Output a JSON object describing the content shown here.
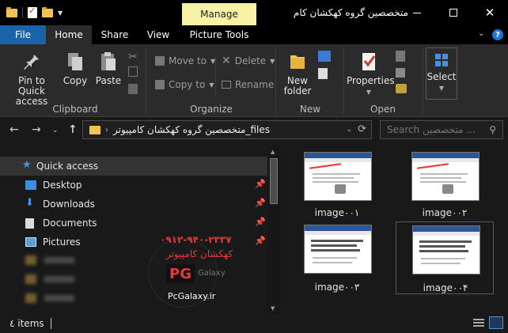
{
  "titlebar": {
    "context_tab": "Manage",
    "title": "متخصصین گروه کهکشان کام"
  },
  "tabs": {
    "file": "File",
    "home": "Home",
    "share": "Share",
    "view": "View",
    "picture_tools": "Picture Tools"
  },
  "ribbon": {
    "clipboard": {
      "label": "Clipboard",
      "pin_line1": "Pin to Quick",
      "pin_line2": "access",
      "copy": "Copy",
      "paste": "Paste"
    },
    "organize": {
      "label": "Organize",
      "move_to": "Move to",
      "copy_to": "Copy to",
      "delete": "Delete",
      "rename": "Rename"
    },
    "new": {
      "label": "New",
      "new_line1": "New",
      "new_line2": "folder"
    },
    "open": {
      "label": "Open",
      "properties": "Properties"
    },
    "select": {
      "label": "Select"
    }
  },
  "address": {
    "path": "متخصصین گروه کهکشان کامپیوتر_files"
  },
  "search": {
    "placeholder": "Search متخصصین ..."
  },
  "nav": {
    "quick_access": "Quick access",
    "items": [
      {
        "label": "Desktop"
      },
      {
        "label": "Downloads"
      },
      {
        "label": "Documents"
      },
      {
        "label": "Pictures"
      }
    ]
  },
  "watermark": {
    "phone": "۰۹۱۲-۹۴۰-۲۳۳۷",
    "brand_fa": "کهکشان کامپیوتر",
    "pg": "PG",
    "galaxy": "Galaxy",
    "url": "PcGalaxy.ir"
  },
  "files": [
    {
      "name": "image۰۰۱"
    },
    {
      "name": "image۰۰۲"
    },
    {
      "name": "image۰۰۳"
    },
    {
      "name": "image۰۰۴"
    }
  ],
  "status": {
    "count": "٤ items"
  },
  "colors": {
    "accent": "#1b63a8",
    "manage_tab": "#f7f2a6",
    "background": "#191919",
    "ribbon": "#2b2b2b"
  }
}
